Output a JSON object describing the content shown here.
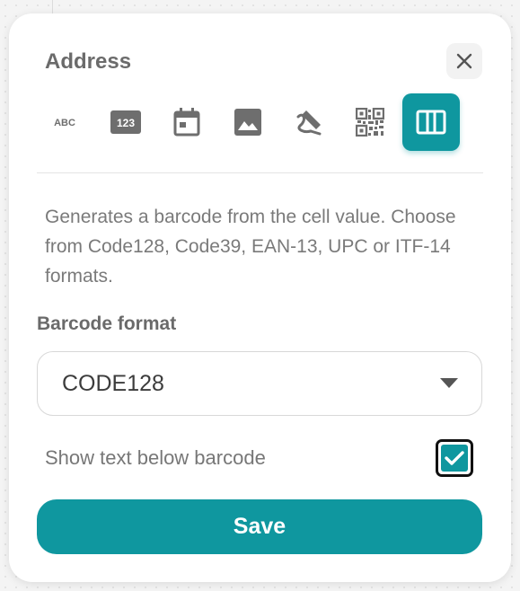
{
  "dialog": {
    "title": "Address",
    "close_icon": "close-icon"
  },
  "column_types": [
    {
      "name": "text",
      "icon": "abc-text-icon",
      "label": "ABC",
      "active": false
    },
    {
      "name": "number",
      "icon": "number-123-icon",
      "label": "123",
      "active": false
    },
    {
      "name": "date",
      "icon": "calendar-icon",
      "active": false
    },
    {
      "name": "image",
      "icon": "image-icon",
      "active": false
    },
    {
      "name": "signature",
      "icon": "signature-icon",
      "active": false
    },
    {
      "name": "qr-code",
      "icon": "qr-code-icon",
      "active": false
    },
    {
      "name": "barcode",
      "icon": "barcode-icon",
      "active": true
    }
  ],
  "description": "Generates a barcode from the cell value. Choose from Code128, Code39, EAN-13, UPC or ITF-14 formats.",
  "barcode_format": {
    "label": "Barcode format",
    "selected": "CODE128"
  },
  "show_text_below": {
    "label": "Show text below barcode",
    "checked": true
  },
  "save_label": "Save",
  "colors": {
    "accent": "#0f979f",
    "icon_gray": "#6e6e6e"
  }
}
